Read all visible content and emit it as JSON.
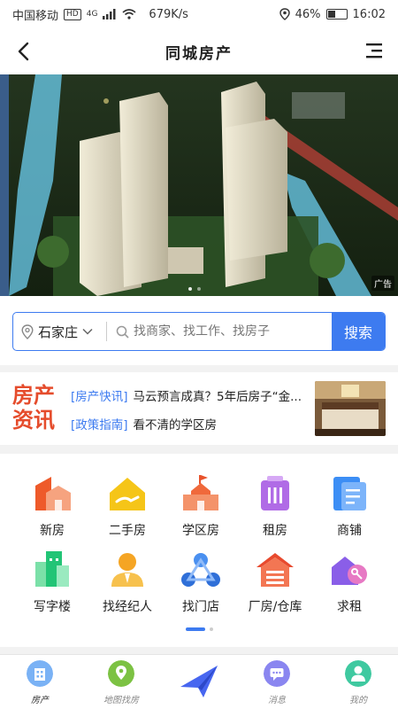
{
  "status_bar": {
    "carrier": "中国移动",
    "hd": "HD",
    "net": "4G",
    "speed": "679K/s",
    "battery": "46%",
    "time": "16:02",
    "battery_level": 0.46
  },
  "header": {
    "title": "同城房产"
  },
  "banner": {
    "ad_label": "广告"
  },
  "search": {
    "city": "石家庄",
    "placeholder": "找商家、找工作、找房子",
    "button": "搜索"
  },
  "news": {
    "logo_line1": "房产",
    "logo_line2": "资讯",
    "items": [
      {
        "tag": "[房产快讯]",
        "text": "马云预言成真？5年后房子“金..."
      },
      {
        "tag": "[政策指南]",
        "text": "看不清的学区房"
      }
    ]
  },
  "categories": [
    {
      "label": "新房",
      "icon": "new-house-icon"
    },
    {
      "label": "二手房",
      "icon": "second-hand-house-icon"
    },
    {
      "label": "学区房",
      "icon": "school-house-icon"
    },
    {
      "label": "租房",
      "icon": "rent-icon"
    },
    {
      "label": "商铺",
      "icon": "shop-icon"
    },
    {
      "label": "写字楼",
      "icon": "office-building-icon"
    },
    {
      "label": "找经纪人",
      "icon": "agent-icon"
    },
    {
      "label": "找门店",
      "icon": "store-icon"
    },
    {
      "label": "厂房/仓库",
      "icon": "warehouse-icon"
    },
    {
      "label": "求租",
      "icon": "seek-rent-icon"
    }
  ],
  "tabs": [
    {
      "label": "房产",
      "icon": "house-tab-icon"
    },
    {
      "label": "地图找房",
      "icon": "map-tab-icon"
    },
    {
      "label": "",
      "icon": "publish-tab-icon"
    },
    {
      "label": "消息",
      "icon": "message-tab-icon"
    },
    {
      "label": "我的",
      "icon": "profile-tab-icon"
    }
  ],
  "colors": {
    "accent": "#3d7bf0",
    "brand_red": "#e54c2c"
  }
}
